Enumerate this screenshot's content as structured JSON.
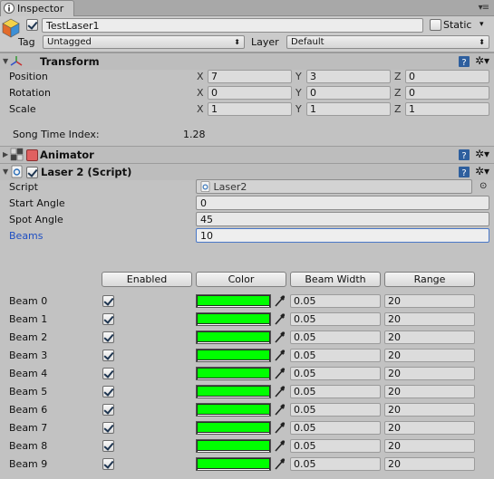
{
  "tab": {
    "label": "Inspector"
  },
  "gameobject": {
    "name": "TestLaser1",
    "active": true,
    "static_label": "Static",
    "static": false,
    "tag_label": "Tag",
    "tag_value": "Untagged",
    "layer_label": "Layer",
    "layer_value": "Default"
  },
  "transform": {
    "title": "Transform",
    "rows": [
      {
        "label": "Position",
        "x": "7",
        "y": "3",
        "z": "0"
      },
      {
        "label": "Rotation",
        "x": "0",
        "y": "0",
        "z": "0"
      },
      {
        "label": "Scale",
        "x": "1",
        "y": "1",
        "z": "1"
      }
    ],
    "axis": {
      "x": "X",
      "y": "Y",
      "z": "Z"
    },
    "song_label": "Song Time Index:",
    "song_value": "1.28"
  },
  "animator": {
    "title": "Animator"
  },
  "laser": {
    "title": "Laser 2 (Script)",
    "enabled": true,
    "script_label": "Script",
    "script_value": "Laser2",
    "start_angle_label": "Start Angle",
    "start_angle_value": "0",
    "spot_angle_label": "Spot Angle",
    "spot_angle_value": "45",
    "beams_label": "Beams",
    "beams_value": "10",
    "columns": [
      "Enabled",
      "Color",
      "Beam Width",
      "Range"
    ],
    "beam_color": "#00ff00",
    "beams": [
      {
        "label": "Beam 0",
        "enabled": true,
        "width": "0.05",
        "range": "20"
      },
      {
        "label": "Beam 1",
        "enabled": true,
        "width": "0.05",
        "range": "20"
      },
      {
        "label": "Beam 2",
        "enabled": true,
        "width": "0.05",
        "range": "20"
      },
      {
        "label": "Beam 3",
        "enabled": true,
        "width": "0.05",
        "range": "20"
      },
      {
        "label": "Beam 4",
        "enabled": true,
        "width": "0.05",
        "range": "20"
      },
      {
        "label": "Beam 5",
        "enabled": true,
        "width": "0.05",
        "range": "20"
      },
      {
        "label": "Beam 6",
        "enabled": true,
        "width": "0.05",
        "range": "20"
      },
      {
        "label": "Beam 7",
        "enabled": true,
        "width": "0.05",
        "range": "20"
      },
      {
        "label": "Beam 8",
        "enabled": true,
        "width": "0.05",
        "range": "20"
      },
      {
        "label": "Beam 9",
        "enabled": true,
        "width": "0.05",
        "range": "20"
      }
    ]
  }
}
